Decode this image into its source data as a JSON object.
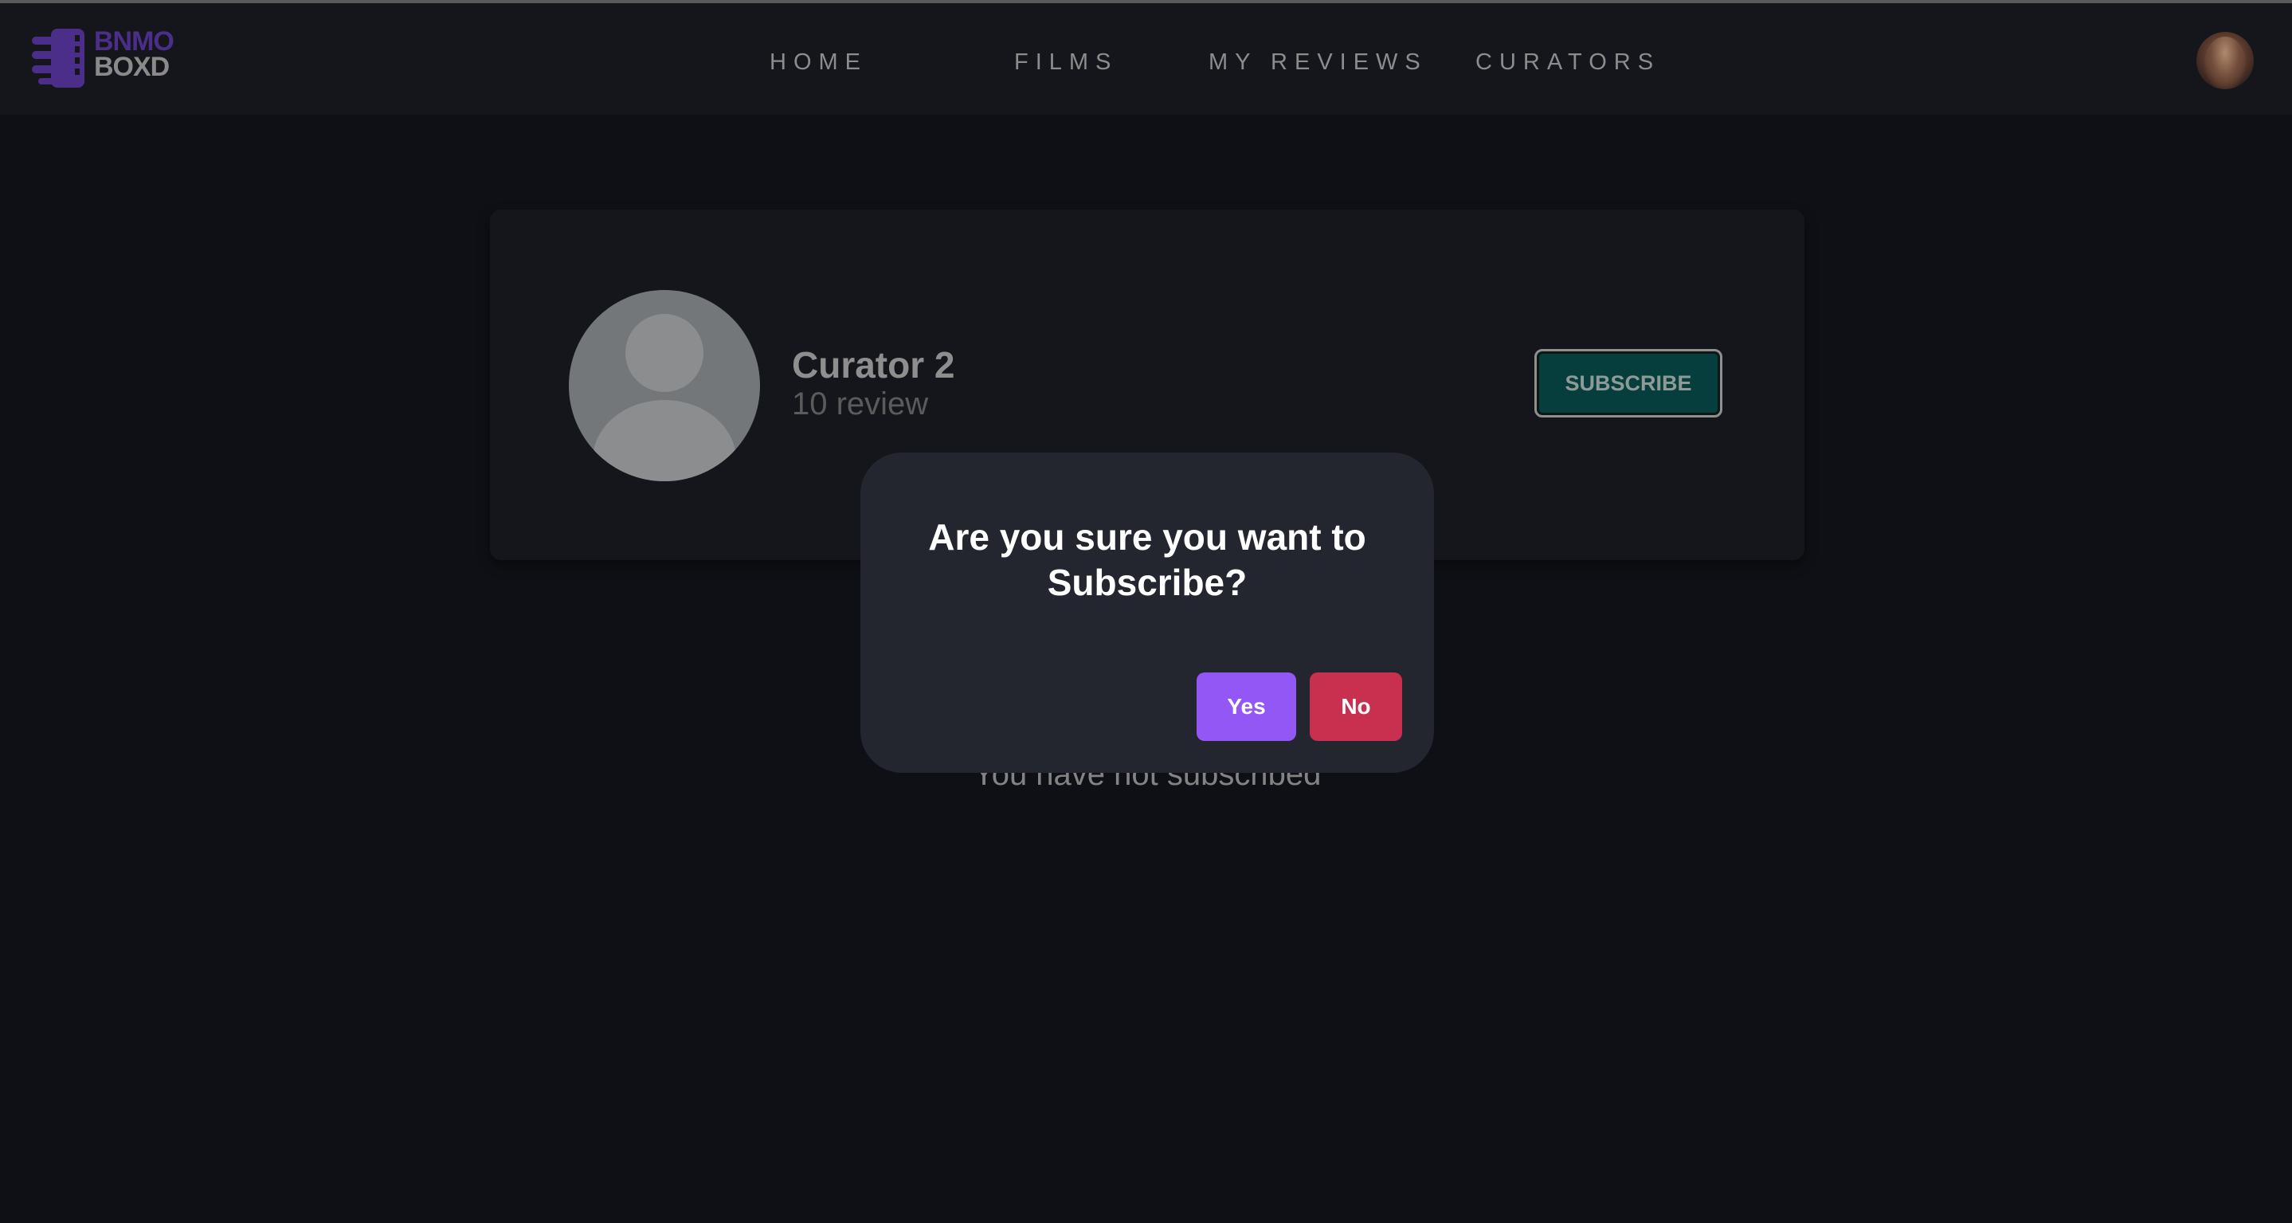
{
  "header": {
    "logo": {
      "line1": "BNMO",
      "line2": "BOXD",
      "icon": "film-logo-icon"
    },
    "nav": [
      {
        "label": "HOME"
      },
      {
        "label": "FILMS"
      },
      {
        "label": "MY REVIEWS"
      },
      {
        "label": "CURATORS"
      }
    ],
    "avatar_icon": "user-avatar"
  },
  "curator": {
    "name": "Curator 2",
    "review_count": "10 review",
    "avatar_icon": "default-user-avatar-icon",
    "subscribe_label": "SUBSCRIBE"
  },
  "status_message": "You have not subscribed",
  "modal": {
    "title": "Are you sure you want to Subscribe?",
    "yes_label": "Yes",
    "no_label": "No"
  },
  "colors": {
    "background": "#0f1015",
    "navbar": "#15161b",
    "modal": "#24262f",
    "logo_accent": "#4b2e8a",
    "subscribe_button": "#063d3d",
    "yes_button": "#9257f5",
    "no_button": "#c9304f"
  }
}
